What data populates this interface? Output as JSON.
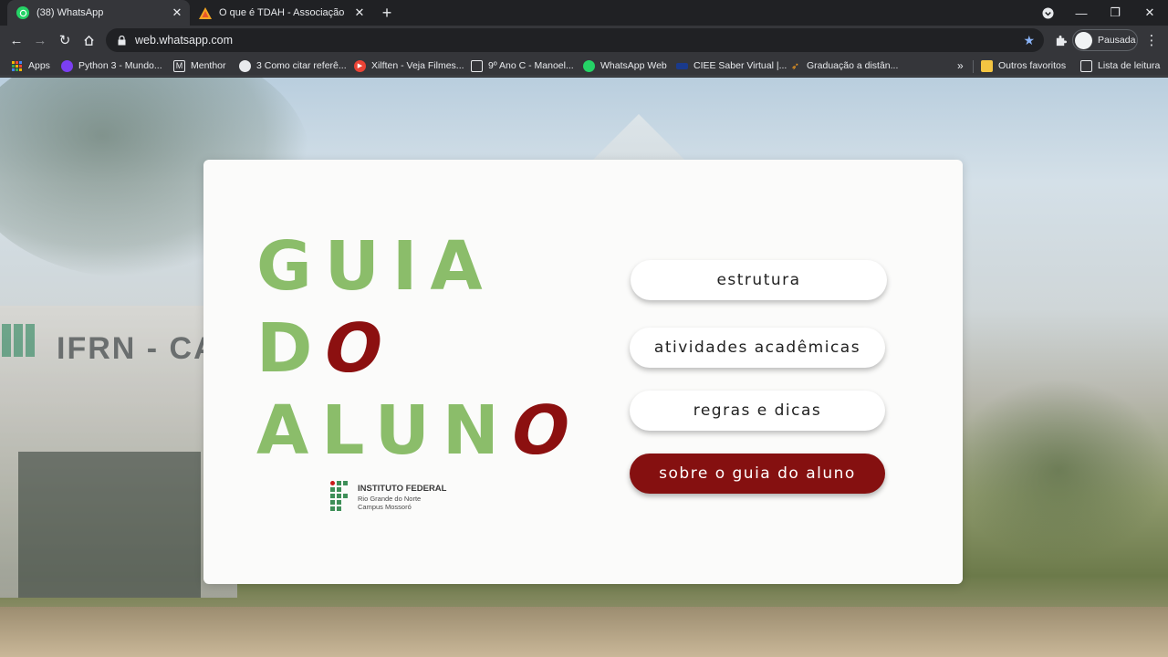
{
  "browser": {
    "tabs": [
      {
        "title": "(38) WhatsApp",
        "icon": "whatsapp-icon",
        "active": true
      },
      {
        "title": "O que é TDAH - Associação Brasi",
        "icon": "warning-triangle-icon",
        "active": false
      }
    ],
    "url": "web.whatsapp.com",
    "profile_label": "Pausada",
    "bookmarks": [
      {
        "label": "Apps",
        "icon": "apps-grid-icon"
      },
      {
        "label": "Python 3 - Mundo...",
        "icon": "python-icon"
      },
      {
        "label": "Menthor",
        "icon": "menthor-icon"
      },
      {
        "label": "3 Como citar referê...",
        "icon": "globe-icon"
      },
      {
        "label": "Xilften - Veja Filmes...",
        "icon": "play-icon"
      },
      {
        "label": "9º Ano C - Manoel...",
        "icon": "classroom-icon"
      },
      {
        "label": "WhatsApp Web",
        "icon": "whatsapp-icon"
      },
      {
        "label": "CIEE Saber Virtual |...",
        "icon": "ciee-icon"
      },
      {
        "label": "Graduação a distân...",
        "icon": "graduation-icon"
      }
    ],
    "bookmarks_overflow": "»",
    "other_favorites": "Outros favoritos",
    "reading_list": "Lista de leitura"
  },
  "page": {
    "title_line1": "GUIA",
    "title_line2_a": "D",
    "title_line2_b": "O",
    "title_line3_a": "ALUN",
    "title_line3_b": "O",
    "institution": {
      "name": "INSTITUTO FEDERAL",
      "line2": "Rio Grande do Norte",
      "line3": "Campus Mossoró"
    },
    "background_sign": "IFRN - CA",
    "menu": [
      {
        "label": "estrutura"
      },
      {
        "label": "atividades acadêmicas"
      },
      {
        "label": "regras e dicas"
      },
      {
        "label": "sobre o guia do aluno"
      }
    ],
    "colors": {
      "green": "#8bbd6a",
      "dark_red": "#8c1010",
      "button_primary": "#851010"
    }
  }
}
